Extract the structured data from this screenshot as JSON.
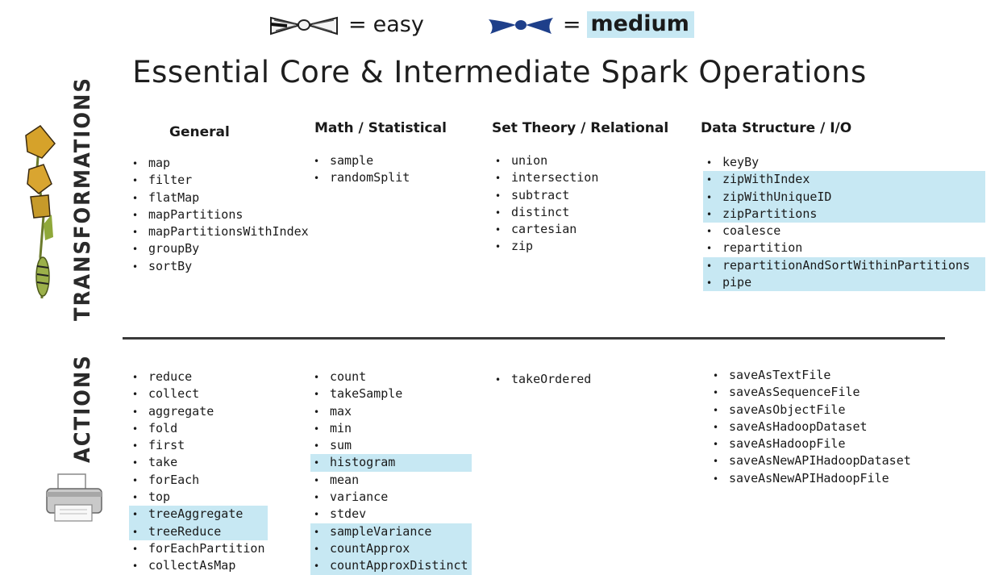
{
  "legend": {
    "easy": {
      "icon": "white-bowtie-icon",
      "eq": "=",
      "label": "easy"
    },
    "medium": {
      "icon": "blue-bowtie-icon",
      "eq": "=",
      "label": "medium",
      "highlight_color": "#c7e8f3",
      "icon_color": "#1e3f8a"
    }
  },
  "title": "Essential Core & Intermediate Spark Operations",
  "sections": {
    "transformations": {
      "label": "TRANSFORMATIONS",
      "icon": "caterpillar-butterfly-icon"
    },
    "actions": {
      "label": "ACTIONS",
      "icon": "printer-icon"
    }
  },
  "columns": [
    "General",
    "Math / Statistical",
    "Set Theory / Relational",
    "Data Structure / I/O"
  ],
  "transformations": {
    "general": [
      {
        "name": "map",
        "medium": false
      },
      {
        "name": "filter",
        "medium": false
      },
      {
        "name": "flatMap",
        "medium": false
      },
      {
        "name": "mapPartitions",
        "medium": false
      },
      {
        "name": "mapPartitionsWithIndex",
        "medium": false
      },
      {
        "name": "groupBy",
        "medium": false
      },
      {
        "name": "sortBy",
        "medium": false
      }
    ],
    "math": [
      {
        "name": "sample",
        "medium": false
      },
      {
        "name": "randomSplit",
        "medium": false
      }
    ],
    "set": [
      {
        "name": "union",
        "medium": false
      },
      {
        "name": "intersection",
        "medium": false
      },
      {
        "name": "subtract",
        "medium": false
      },
      {
        "name": "distinct",
        "medium": false
      },
      {
        "name": "cartesian",
        "medium": false
      },
      {
        "name": "zip",
        "medium": false
      }
    ],
    "data": [
      {
        "name": "keyBy",
        "medium": false
      },
      {
        "name": "zipWithIndex",
        "medium": true
      },
      {
        "name": "zipWithUniqueID",
        "medium": true
      },
      {
        "name": "zipPartitions",
        "medium": true
      },
      {
        "name": "coalesce",
        "medium": false
      },
      {
        "name": "repartition",
        "medium": false
      },
      {
        "name": "repartitionAndSortWithinPartitions",
        "medium": true
      },
      {
        "name": "pipe",
        "medium": true
      }
    ]
  },
  "actions": {
    "general": [
      {
        "name": "reduce",
        "medium": false
      },
      {
        "name": "collect",
        "medium": false
      },
      {
        "name": "aggregate",
        "medium": false
      },
      {
        "name": "fold",
        "medium": false
      },
      {
        "name": "first",
        "medium": false
      },
      {
        "name": "take",
        "medium": false
      },
      {
        "name": "forEach",
        "medium": false
      },
      {
        "name": "top",
        "medium": false
      },
      {
        "name": "treeAggregate",
        "medium": true
      },
      {
        "name": "treeReduce",
        "medium": true
      },
      {
        "name": "forEachPartition",
        "medium": false
      },
      {
        "name": "collectAsMap",
        "medium": false
      }
    ],
    "math": [
      {
        "name": "count",
        "medium": false
      },
      {
        "name": "takeSample",
        "medium": false
      },
      {
        "name": "max",
        "medium": false
      },
      {
        "name": "min",
        "medium": false
      },
      {
        "name": "sum",
        "medium": false
      },
      {
        "name": "histogram",
        "medium": true
      },
      {
        "name": "mean",
        "medium": false
      },
      {
        "name": "variance",
        "medium": false
      },
      {
        "name": "stdev",
        "medium": false
      },
      {
        "name": "sampleVariance",
        "medium": true
      },
      {
        "name": "countApprox",
        "medium": true
      },
      {
        "name": "countApproxDistinct",
        "medium": true
      }
    ],
    "set": [
      {
        "name": "takeOrdered",
        "medium": false
      }
    ],
    "data": [
      {
        "name": "saveAsTextFile",
        "medium": false
      },
      {
        "name": "saveAsSequenceFile",
        "medium": false
      },
      {
        "name": "saveAsObjectFile",
        "medium": false
      },
      {
        "name": "saveAsHadoopDataset",
        "medium": false
      },
      {
        "name": "saveAsHadoopFile",
        "medium": false
      },
      {
        "name": "saveAsNewAPIHadoopDataset",
        "medium": false
      },
      {
        "name": "saveAsNewAPIHadoopFile",
        "medium": false
      }
    ]
  }
}
